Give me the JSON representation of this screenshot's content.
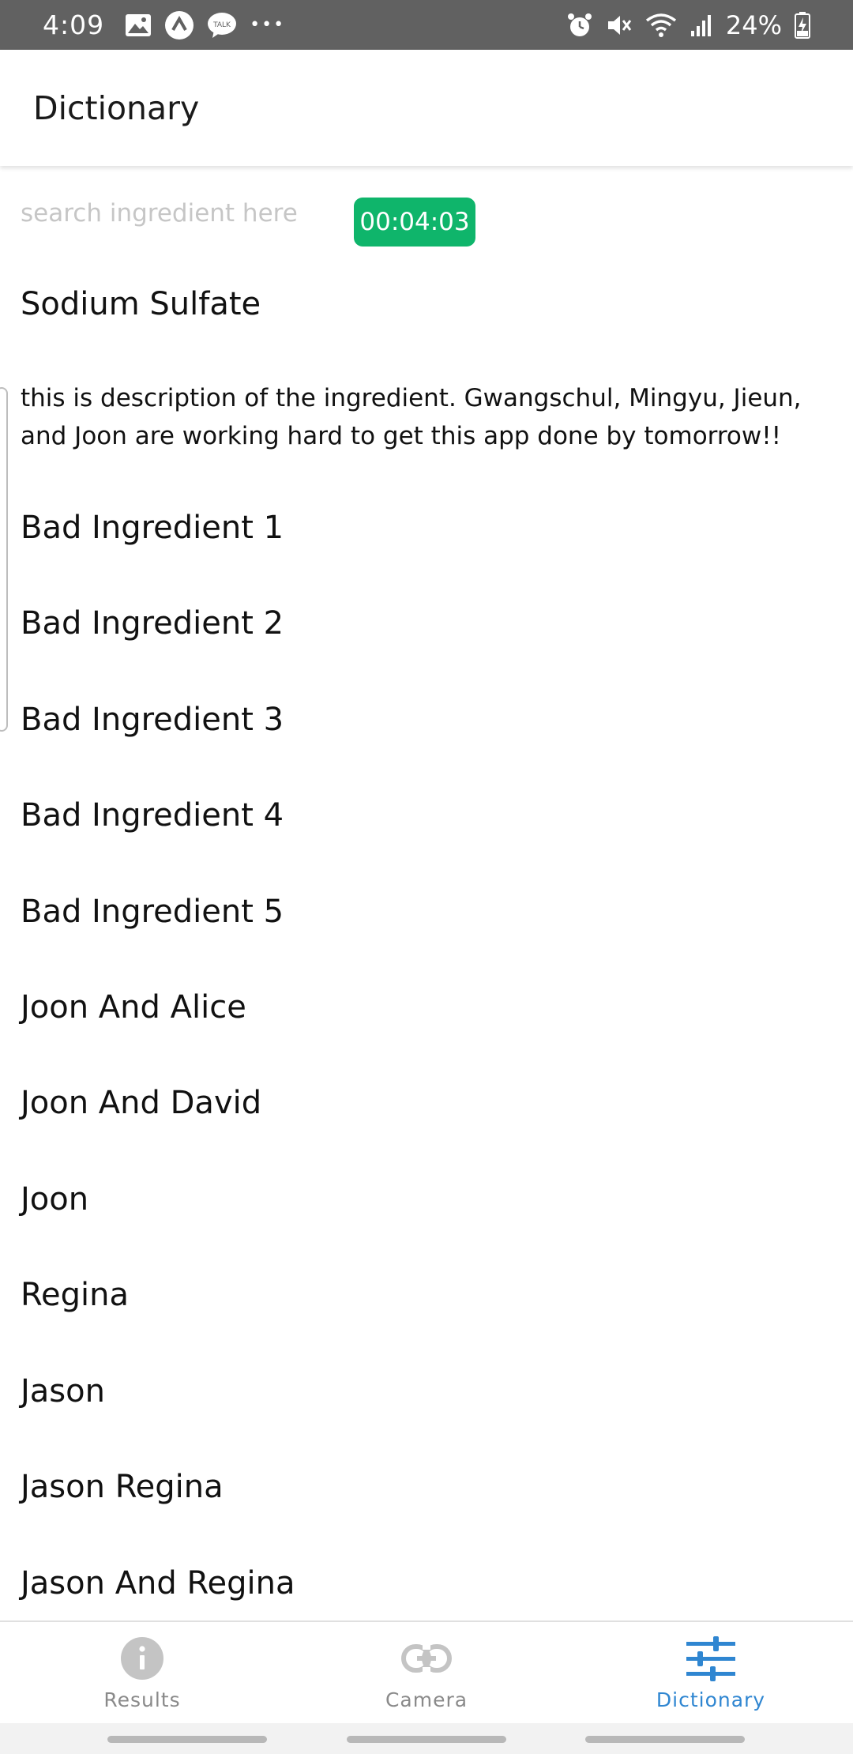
{
  "status_bar": {
    "time": "4:09",
    "battery_percent": "24%",
    "left_icons": [
      "gallery-icon",
      "app-logo-icon",
      "kakaotalk-icon",
      "more-dots-icon"
    ],
    "right_icons": [
      "alarm-icon",
      "mute-icon",
      "wifi-icon",
      "signal-icon",
      "battery-charging-icon"
    ],
    "talk_badge": "TALK",
    "more": "•••"
  },
  "app_bar": {
    "title": "Dictionary"
  },
  "search": {
    "placeholder": "search ingredient here",
    "value": ""
  },
  "timer": {
    "value": "00:04:03",
    "color": "#0fb56b"
  },
  "ingredient": {
    "name": "Sodium Sulfate",
    "description": "this is description of the ingredient. Gwangschul, Mingyu, Jieun, and Joon are working hard to get this app done by tomorrow!!"
  },
  "list": [
    "Bad Ingredient 1",
    "Bad Ingredient 2",
    "Bad Ingredient 3",
    "Bad Ingredient 4",
    "Bad Ingredient 5",
    "Joon And Alice",
    "Joon And David",
    "Joon",
    "Regina",
    "Jason",
    "Jason Regina",
    "Jason And Regina"
  ],
  "bottom_nav": {
    "tabs": [
      {
        "label": "Results",
        "icon": "info-icon",
        "active": false
      },
      {
        "label": "Camera",
        "icon": "link-icon",
        "active": false
      },
      {
        "label": "Dictionary",
        "icon": "sliders-icon",
        "active": true
      }
    ],
    "active_color": "#2f86d1",
    "inactive_color": "#8a8a8a"
  }
}
